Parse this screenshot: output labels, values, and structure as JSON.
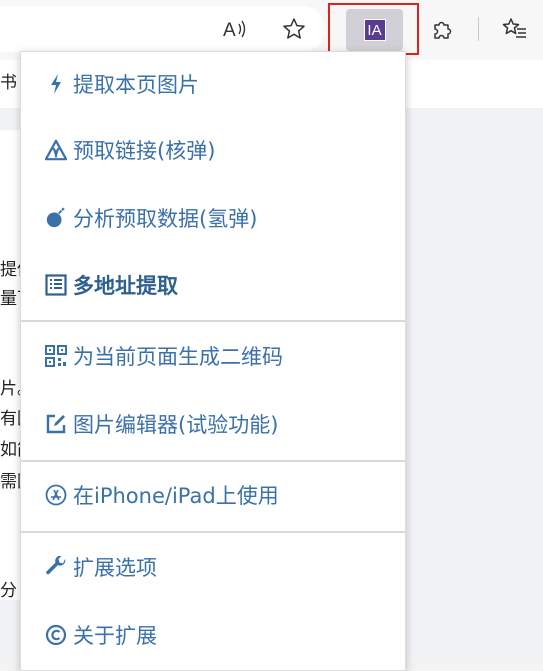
{
  "toolbar": {
    "icons": [
      "read-aloud-icon",
      "favorite-star-icon",
      "extension-ia-icon",
      "extensions-puzzle-icon",
      "favorites-list-icon"
    ],
    "ext_logo": "IA"
  },
  "page_fragments": [
    "书",
    "提供",
    "量下",
    "片。",
    "有图",
    "如简",
    "需图",
    "分"
  ],
  "menu": {
    "items": [
      {
        "label": "提取本页图片",
        "icon": "bolt-icon"
      },
      {
        "label": "预取链接(核弹)",
        "icon": "radiation-warning-icon"
      },
      {
        "label": "分析预取数据(氢弹)",
        "icon": "bomb-icon"
      },
      {
        "label": "多地址提取",
        "icon": "list-document-icon"
      },
      {
        "label": "为当前页面生成二维码",
        "icon": "qrcode-icon"
      },
      {
        "label": "图片编辑器(试验功能)",
        "icon": "edit-icon"
      },
      {
        "label": "在iPhone/iPad上使用",
        "icon": "appstore-icon"
      },
      {
        "label": "扩展选项",
        "icon": "wrench-icon"
      },
      {
        "label": "关于扩展",
        "icon": "copyright-icon"
      }
    ]
  },
  "colors": {
    "menu_text": "#3a71a8",
    "highlight_border": "#e02020",
    "ext_logo_bg": "#5b3d8f"
  }
}
